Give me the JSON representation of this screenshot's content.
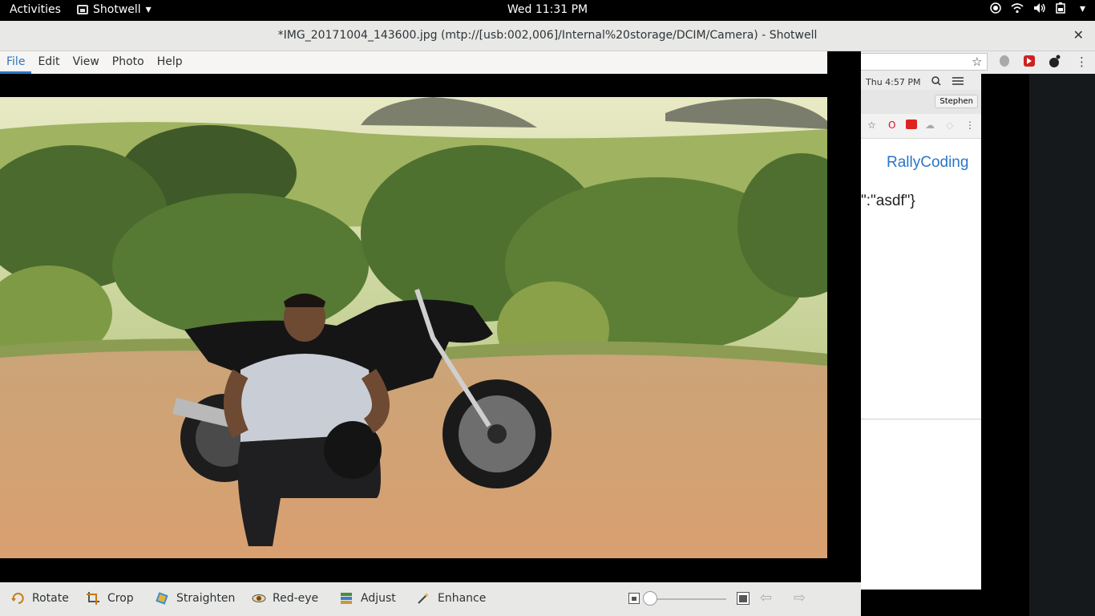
{
  "topbar": {
    "activities": "Activities",
    "app_name": "Shotwell",
    "app_arrow": "▾",
    "clock": "Wed 11:31 PM",
    "tray": {
      "icons": [
        "record-icon",
        "wifi-icon",
        "volume-icon",
        "battery-icon"
      ],
      "dropdown": "▾"
    }
  },
  "window": {
    "title": "*IMG_20171004_143600.jpg (mtp://[usb:002,006]/Internal%20storage/DCIM/Camera) - Shotwell",
    "close": "✕"
  },
  "menu": {
    "items": [
      "File",
      "Edit",
      "View",
      "Photo",
      "Help"
    ],
    "active": "File"
  },
  "toolbar": {
    "rotate": "Rotate",
    "crop": "Crop",
    "straighten": "Straighten",
    "red_eye": "Red-eye",
    "adjust": "Adjust",
    "enhance": "Enhance",
    "zoom_level": 0,
    "prev": "⇦",
    "next": "⇨"
  },
  "background_app": {
    "menubar_clock": "Thu 4:57 PM",
    "user_tab": "Stephen",
    "heading": "RallyCoding",
    "json_fragment": "\":\"asdf\"}"
  },
  "colors": {
    "accent": "#2a76c6",
    "toolbar_bg": "#e8e8e7"
  }
}
